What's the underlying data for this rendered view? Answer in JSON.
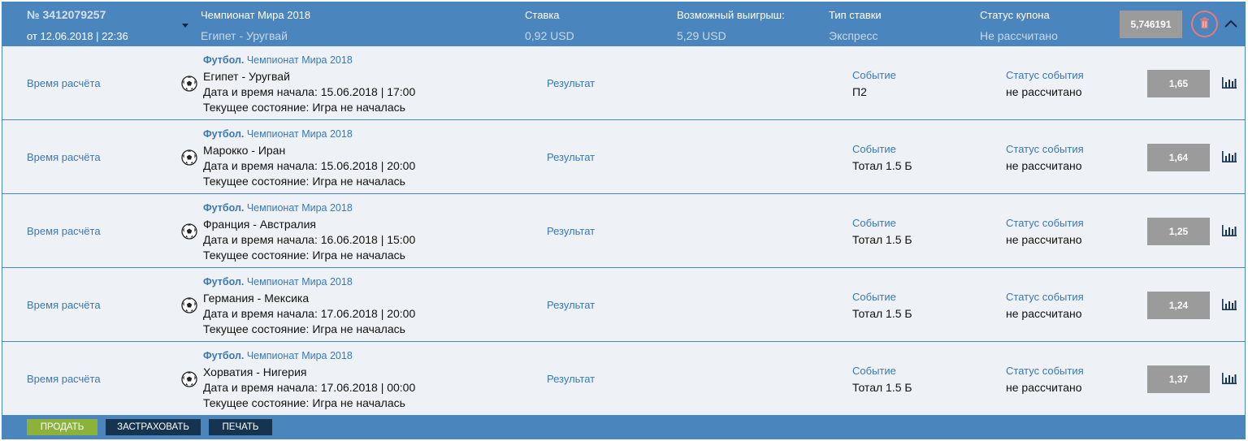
{
  "coupon": {
    "number": "№ 3412079257",
    "date": "от 12.06.2018 | 22:36",
    "title_label": "Чемпионат Мира 2018",
    "title_value": "Египет - Уругвай",
    "stake_label": "Ставка",
    "stake_value": "0,92 USD",
    "payout_label": "Возможный выигрыш:",
    "payout_value": "5,29 USD",
    "type_label": "Тип ставки",
    "type_value": "Экспресс",
    "status_label": "Статус купона",
    "status_value": "Не рассчитано",
    "total_coef": "5,746191"
  },
  "labels": {
    "calc_time": "Время расчёта",
    "sport": "Футбол.",
    "result": "Результат",
    "event": "Событие",
    "event_status": "Статус события"
  },
  "rows": [
    {
      "league": "Чемпионат Мира 2018",
      "teams": "Египет - Уругвай",
      "start": "Дата и время начала: 15.06.2018 | 17:00",
      "state": "Текущее состояние: Игра не началась",
      "event": "П2",
      "status": "не рассчитано",
      "odds": "1,65"
    },
    {
      "league": "Чемпионат Мира 2018",
      "teams": "Марокко - Иран",
      "start": "Дата и время начала: 15.06.2018 | 20:00",
      "state": "Текущее состояние: Игра не началась",
      "event": "Тотал 1.5 Б",
      "status": "не рассчитано",
      "odds": "1,64"
    },
    {
      "league": "Чемпионат Мира 2018",
      "teams": "Франция - Австралия",
      "start": "Дата и время начала: 16.06.2018 | 15:00",
      "state": "Текущее состояние: Игра не началась",
      "event": "Тотал 1.5 Б",
      "status": "не рассчитано",
      "odds": "1,25"
    },
    {
      "league": "Чемпионат Мира 2018",
      "teams": "Германия - Мексика",
      "start": "Дата и время начала: 17.06.2018 | 20:00",
      "state": "Текущее состояние: Игра не началась",
      "event": "Тотал 1.5 Б",
      "status": "не рассчитано",
      "odds": "1,24"
    },
    {
      "league": "Чемпионат Мира 2018",
      "teams": "Хорватия - Нигерия",
      "start": "Дата и время начала: 17.06.2018 | 00:00",
      "state": "Текущее состояние: Игра не началась",
      "event": "Тотал 1.5 Б",
      "status": "не рассчитано",
      "odds": "1,37"
    }
  ],
  "footer": {
    "sell": "ПРОДАТЬ",
    "insure": "ЗАСТРАХОВАТЬ",
    "print": "ПЕЧАТЬ"
  },
  "colors": {
    "header_bg": "#4a85bd",
    "row_bg": "#eef2f6",
    "link": "#3a78b4",
    "odds_bg": "#9b9b9b",
    "sell_bg": "#8bb33a",
    "dark_btn": "#16344f",
    "trash_ring": "#e57b7b"
  },
  "icons": {
    "ball": "soccer-ball-icon",
    "stats": "bar-chart-icon",
    "trash": "trash-icon",
    "collapse": "chevron-up-icon",
    "dropdown": "caret-down-icon"
  }
}
